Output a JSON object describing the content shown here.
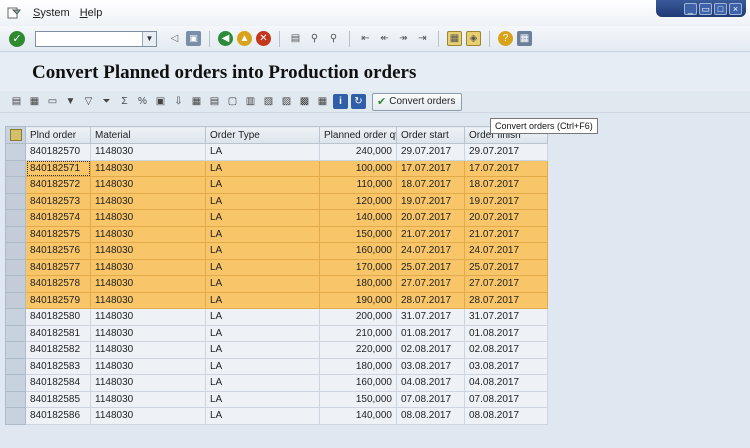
{
  "menubar": {
    "items": [
      {
        "label": "System",
        "mnemonic": "S",
        "rest": "ystem"
      },
      {
        "label": "Help",
        "mnemonic": "H",
        "rest": "elp"
      }
    ],
    "window_controls": [
      "minimize",
      "restore",
      "maximize",
      "close"
    ]
  },
  "toolbar": {
    "command_field_value": "",
    "icons": [
      "enter-icon",
      "back-icon",
      "save-icon",
      "back-nav-icon",
      "exit-icon",
      "cancel-icon",
      "print-icon",
      "find-icon",
      "find-next-icon",
      "first-page-icon",
      "prev-page-icon",
      "next-page-icon",
      "last-page-icon",
      "new-session-icon",
      "shortcut-icon",
      "help-icon",
      "layout-icon"
    ]
  },
  "title": "Convert Planned orders into Production orders",
  "app_toolbar": {
    "convert_button_label": "Convert orders",
    "tooltip": "Convert orders   (Ctrl+F6)"
  },
  "grid": {
    "columns": [
      "Plnd order",
      "Material",
      "Order Type",
      "Planned order qty",
      "Order start",
      "Order finish"
    ],
    "rows": [
      {
        "order": "840182570",
        "material": "1148030",
        "type": "LA",
        "qty": "240,000",
        "start": "29.07.2017",
        "finish": "29.07.2017",
        "highlight": false
      },
      {
        "order": "840182571",
        "material": "1148030",
        "type": "LA",
        "qty": "100,000",
        "start": "17.07.2017",
        "finish": "17.07.2017",
        "highlight": true
      },
      {
        "order": "840182572",
        "material": "1148030",
        "type": "LA",
        "qty": "110,000",
        "start": "18.07.2017",
        "finish": "18.07.2017",
        "highlight": true
      },
      {
        "order": "840182573",
        "material": "1148030",
        "type": "LA",
        "qty": "120,000",
        "start": "19.07.2017",
        "finish": "19.07.2017",
        "highlight": true
      },
      {
        "order": "840182574",
        "material": "1148030",
        "type": "LA",
        "qty": "140,000",
        "start": "20.07.2017",
        "finish": "20.07.2017",
        "highlight": true
      },
      {
        "order": "840182575",
        "material": "1148030",
        "type": "LA",
        "qty": "150,000",
        "start": "21.07.2017",
        "finish": "21.07.2017",
        "highlight": true
      },
      {
        "order": "840182576",
        "material": "1148030",
        "type": "LA",
        "qty": "160,000",
        "start": "24.07.2017",
        "finish": "24.07.2017",
        "highlight": true
      },
      {
        "order": "840182577",
        "material": "1148030",
        "type": "LA",
        "qty": "170,000",
        "start": "25.07.2017",
        "finish": "25.07.2017",
        "highlight": true
      },
      {
        "order": "840182578",
        "material": "1148030",
        "type": "LA",
        "qty": "180,000",
        "start": "27.07.2017",
        "finish": "27.07.2017",
        "highlight": true
      },
      {
        "order": "840182579",
        "material": "1148030",
        "type": "LA",
        "qty": "190,000",
        "start": "28.07.2017",
        "finish": "28.07.2017",
        "highlight": true
      },
      {
        "order": "840182580",
        "material": "1148030",
        "type": "LA",
        "qty": "200,000",
        "start": "31.07.2017",
        "finish": "31.07.2017",
        "highlight": false
      },
      {
        "order": "840182581",
        "material": "1148030",
        "type": "LA",
        "qty": "210,000",
        "start": "01.08.2017",
        "finish": "01.08.2017",
        "highlight": false
      },
      {
        "order": "840182582",
        "material": "1148030",
        "type": "LA",
        "qty": "220,000",
        "start": "02.08.2017",
        "finish": "02.08.2017",
        "highlight": false
      },
      {
        "order": "840182583",
        "material": "1148030",
        "type": "LA",
        "qty": "180,000",
        "start": "03.08.2017",
        "finish": "03.08.2017",
        "highlight": false
      },
      {
        "order": "840182584",
        "material": "1148030",
        "type": "LA",
        "qty": "160,000",
        "start": "04.08.2017",
        "finish": "04.08.2017",
        "highlight": false
      },
      {
        "order": "840182585",
        "material": "1148030",
        "type": "LA",
        "qty": "150,000",
        "start": "07.08.2017",
        "finish": "07.08.2017",
        "highlight": false
      },
      {
        "order": "840182586",
        "material": "1148030",
        "type": "LA",
        "qty": "140,000",
        "start": "08.08.2017",
        "finish": "08.08.2017",
        "highlight": false
      }
    ]
  },
  "colors": {
    "highlight_row": "#f8c568",
    "normal_row": "#eef2f7",
    "background": "#dfe8f0",
    "window_controls": "#1f3a73",
    "check_green": "#2f8a2f"
  }
}
